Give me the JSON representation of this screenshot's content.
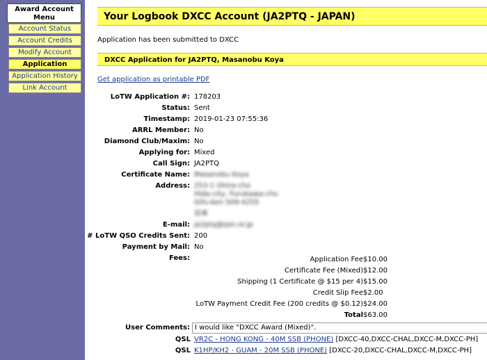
{
  "sidebar": {
    "title": "Award Account Menu",
    "items": [
      {
        "label": "Account Status"
      },
      {
        "label": "Account Credits"
      },
      {
        "label": "Modify Account"
      },
      {
        "label": "Application"
      },
      {
        "label": "Application History"
      },
      {
        "label": "Link Account"
      }
    ]
  },
  "header": {
    "title": "Your Logbook DXCC Account (JA2PTQ - JAPAN)"
  },
  "submitted_msg": "Application has been submitted to DXCC",
  "section": {
    "title": "DXCC Application for JA2PTQ, Masanobu Koya"
  },
  "pdf_link": "Get application as printable PDF",
  "fields": {
    "app_no_label": "LoTW Application #:",
    "app_no": "178203",
    "status_label": "Status:",
    "status": "Sent",
    "timestamp_label": "Timestamp:",
    "timestamp": "2019-01-23 07:55:36",
    "arrl_label": "ARRL Member:",
    "arrl": "No",
    "diamond_label": "Diamond Club/Maxim:",
    "diamond": "No",
    "applying_label": "Applying for:",
    "applying": "Mixed",
    "callsign_label": "Call Sign:",
    "callsign": "JA2PTQ",
    "cert_name_label": "Certificate Name:",
    "cert_name": "Masanobu Koya",
    "address_label": "Address:",
    "address_lines": [
      "253-1 Ohira-cho",
      "Hida-city, Furukawa-cho",
      "Gifu-ken 509-4255",
      "日本"
    ],
    "email_label": "E-mail:",
    "email": "ja2ptq@qsn.or.jp",
    "credits_label": "# LoTW QSO Credits Sent:",
    "credits": "200",
    "mail_label": "Payment by Mail:",
    "mail": "No",
    "fees_label": "Fees:"
  },
  "fees": [
    {
      "label": "Application Fee",
      "value": "$10.00"
    },
    {
      "label": "Certificate Fee (Mixed)",
      "value": "$12.00"
    },
    {
      "label": "Shipping (1 Certificate @ $15 per 4)",
      "value": "$15.00"
    },
    {
      "label": "Credit Slip Fee",
      "value": "$2.00"
    },
    {
      "label": "LoTW Payment Credit Fee (200 credits @ $0.12)",
      "value": "$24.00"
    },
    {
      "label": "Total",
      "value": "$63.00"
    }
  ],
  "comments_label": "User Comments:",
  "comments": "I would like \"DXCC Award (Mixed)\".",
  "qsl_label": "QSL",
  "qsl": [
    {
      "link": "VR2C - HONG KONG - 40M SSB (PHONE)",
      "tags": " [DXCC-40,DXCC-CHAL,DXCC-M,DXCC-PH]"
    },
    {
      "link": "K1HP/KH2 - GUAM - 20M SSB (PHONE)",
      "tags": " [DXCC-20,DXCC-CHAL,DXCC-M,DXCC-PH]"
    }
  ]
}
